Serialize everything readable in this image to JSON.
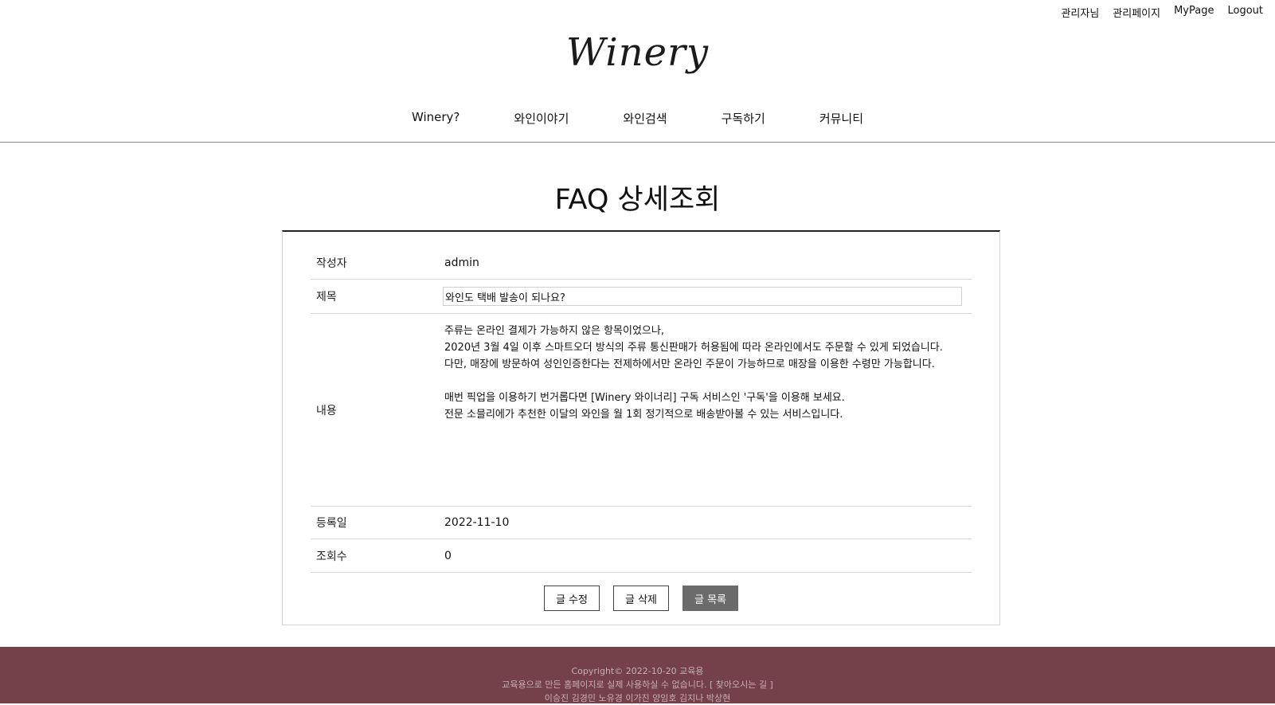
{
  "util_nav": {
    "admin_name": "관리자님",
    "admin_page": "관리페이지",
    "mypage": "MyPage",
    "logout": "Logout"
  },
  "logo": {
    "text": "Winery"
  },
  "main_nav": {
    "items": [
      {
        "label": "Winery?"
      },
      {
        "label": "와인이야기"
      },
      {
        "label": "와인검색"
      },
      {
        "label": "구독하기"
      },
      {
        "label": "커뮤니티"
      }
    ]
  },
  "page": {
    "title": "FAQ 상세조회"
  },
  "detail": {
    "writer_label": "작성자",
    "writer_value": "admin",
    "subject_label": "제목",
    "subject_value": "와인도 택배 발송이 되나요?",
    "content_label": "내용",
    "content_lines": [
      "주류는 온라인 결제가 가능하지 않은 항목이었으나,",
      "2020년 3월 4일 이후 스마트오더 방식의 주류 통신판매가 허용됨에 따라 온라인에서도 주문할 수 있게 되었습니다.",
      "다만, 매장에 방문하여 성인인증한다는 전제하에서만 온라인 주문이 가능하므로 매장을 이용한 수령만 가능합니다.",
      "",
      "매번 픽업을 이용하기 번거롭다면 [Winery 와이너리] 구독 서비스인 '구독'을 이용해 보세요.",
      "전문 소믈리에가 추천한 이달의 와인을 월 1회 정기적으로 배송받아볼 수 있는 서비스입니다."
    ],
    "date_label": "등록일",
    "date_value": "2022-11-10",
    "views_label": "조회수",
    "views_value": "0"
  },
  "buttons": {
    "edit": "글 수정",
    "delete": "글 삭제",
    "list": "글 목록"
  },
  "footer": {
    "copyright": "Copyright© 2022-10-20 교육용",
    "notice": "교육용으로 만든 홈페이지로 실제 사용하실 수 없습니다.",
    "directions": "[ 찾아오시는 길 ]",
    "members": "이승진 김경민 노유경 이가진 양임호 김지나 박상현"
  },
  "colors": {
    "footer_bg": "#74404a",
    "footer_text": "#c9aeb2",
    "list_button_bg": "#6b6b6b"
  }
}
